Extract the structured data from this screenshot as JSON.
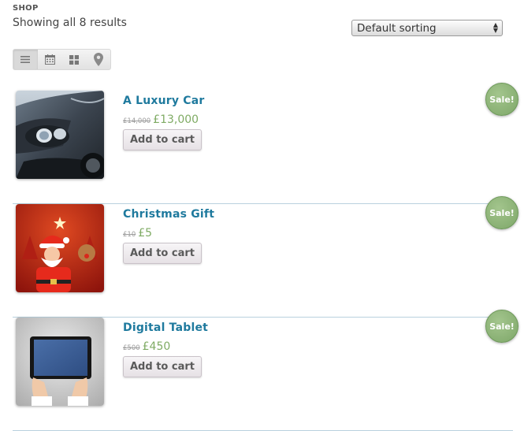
{
  "header": {
    "shop_label": "SHOP",
    "result_count": "Showing all 8 results"
  },
  "sorting": {
    "selected": "Default sorting"
  },
  "view_switcher": {
    "views": [
      "list-view-icon",
      "calendar-view-icon",
      "grid-view-icon",
      "map-view-icon"
    ],
    "active": "list-view-icon"
  },
  "products": [
    {
      "title": "A Luxury Car",
      "old_price": "£14,000",
      "price": "£13,000",
      "button": "Add to cart",
      "badge": "Sale!"
    },
    {
      "title": "Christmas Gift",
      "old_price": "£10",
      "price": "£5",
      "button": "Add to cart",
      "badge": "Sale!"
    },
    {
      "title": "Digital Tablet",
      "old_price": "£500",
      "price": "£450",
      "button": "Add to cart",
      "badge": "Sale!"
    }
  ],
  "colors": {
    "title": "#1f7a9e",
    "price": "#7fab64",
    "sale_badge": "#8fb67a",
    "divider": "#b9d1de"
  }
}
